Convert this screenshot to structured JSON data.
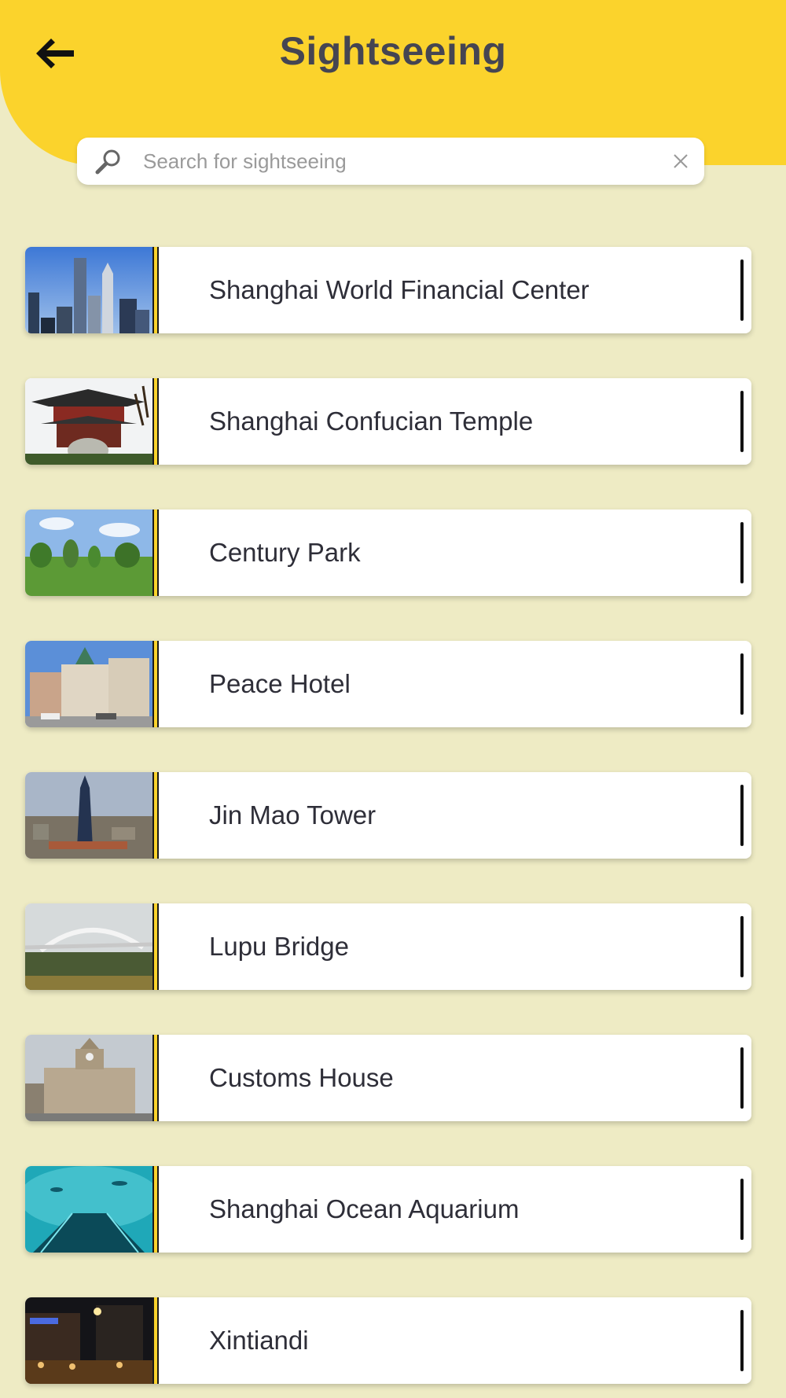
{
  "header": {
    "title": "Sightseeing",
    "back_icon": "back-arrow-icon",
    "background_color": "#fbd32c"
  },
  "search": {
    "placeholder": "Search for sightseeing",
    "value": "",
    "icon": "search-icon",
    "clear_icon": "close-icon"
  },
  "list": {
    "items": [
      {
        "label": "Shanghai World Financial Center",
        "thumbnail": "skyscraper-skyline-photo"
      },
      {
        "label": "Shanghai Confucian Temple",
        "thumbnail": "temple-pavilion-photo"
      },
      {
        "label": "Century Park",
        "thumbnail": "park-topiary-photo"
      },
      {
        "label": "Peace Hotel",
        "thumbnail": "historic-hotel-photo"
      },
      {
        "label": "Jin Mao Tower",
        "thumbnail": "tower-cityscape-photo"
      },
      {
        "label": "Lupu Bridge",
        "thumbnail": "arch-bridge-photo"
      },
      {
        "label": "Customs House",
        "thumbnail": "customs-building-photo"
      },
      {
        "label": "Shanghai Ocean Aquarium",
        "thumbnail": "aquarium-tunnel-photo"
      },
      {
        "label": "Xintiandi",
        "thumbnail": "night-street-photo"
      }
    ]
  },
  "colors": {
    "background": "#eeebc4",
    "accent": "#fbd32c",
    "title_text": "#454552"
  }
}
